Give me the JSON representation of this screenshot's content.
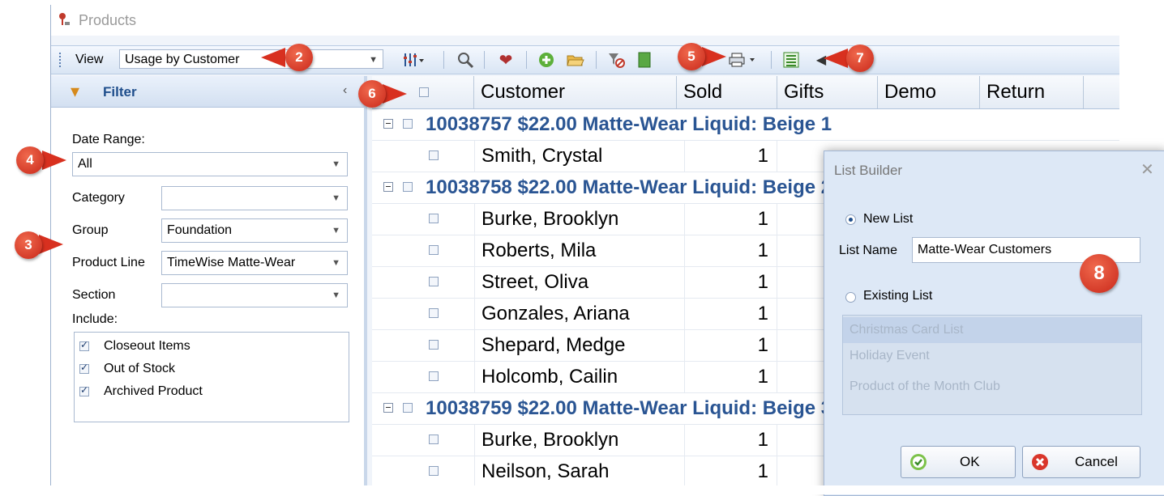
{
  "window": {
    "title": "Products"
  },
  "toolbar": {
    "view_label": "View",
    "view_value": "Usage by Customer",
    "icons": [
      "columns-icon",
      "search-icon",
      "heart-icon",
      "add-icon",
      "open-folder-icon",
      "clear-filter-icon",
      "export-icon",
      "print-icon",
      "list-icon",
      "back-icon"
    ]
  },
  "filter": {
    "title": "Filter",
    "date_range_label": "Date Range:",
    "date_range_value": "All",
    "category_label": "Category",
    "category_value": "",
    "group_label": "Group",
    "group_value": "Foundation",
    "product_line_label": "Product Line",
    "product_line_value": "TimeWise Matte-Wear",
    "section_label": "Section",
    "section_value": "",
    "include_label": "Include:",
    "include_items": [
      {
        "label": "Closeout Items",
        "checked": true
      },
      {
        "label": "Out of Stock",
        "checked": true
      },
      {
        "label": "Archived Product",
        "checked": true
      }
    ]
  },
  "grid": {
    "columns": [
      "Customer",
      "Sold",
      "Gifts",
      "Demo",
      "Return"
    ],
    "groups": [
      {
        "title": "10038757  $22.00  Matte-Wear Liquid: Beige 1",
        "rows": [
          {
            "customer": "Smith, Crystal",
            "sold": "1"
          }
        ]
      },
      {
        "title": "10038758  $22.00  Matte-Wear Liquid: Beige 2",
        "rows": [
          {
            "customer": "Burke, Brooklyn",
            "sold": "1"
          },
          {
            "customer": "Roberts, Mila",
            "sold": "1"
          },
          {
            "customer": "Street, Oliva",
            "sold": "1"
          },
          {
            "customer": "Gonzales, Ariana",
            "sold": "1"
          },
          {
            "customer": "Shepard, Medge",
            "sold": "1"
          },
          {
            "customer": "Holcomb, Cailin",
            "sold": "1"
          }
        ]
      },
      {
        "title": "10038759  $22.00  Matte-Wear Liquid: Beige 3",
        "rows": [
          {
            "customer": "Burke, Brooklyn",
            "sold": "1"
          },
          {
            "customer": "Neilson, Sarah",
            "sold": "1"
          }
        ]
      }
    ]
  },
  "dialog": {
    "title": "List Builder",
    "new_list_label": "New List",
    "list_name_label": "List Name",
    "list_name_value": "Matte-Wear Customers",
    "existing_list_label": "Existing List",
    "existing_items": [
      "Christmas Card List",
      "Holiday Event",
      "Product of the Month Club"
    ],
    "ok_label": "OK",
    "cancel_label": "Cancel"
  },
  "callouts": [
    "2",
    "3",
    "4",
    "5",
    "6",
    "7",
    "8"
  ]
}
